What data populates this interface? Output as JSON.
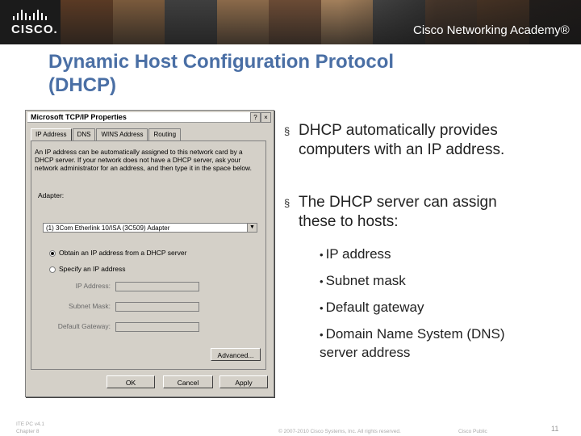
{
  "header": {
    "logo_text": "CISCO.",
    "academy_text": "Cisco Networking Academy®",
    "photo_colors": [
      "#5a3a24",
      "#7a5a3c",
      "#3f3f3f",
      "#8b6a4a",
      "#6b4b35",
      "#a27f5b",
      "#4d4d4d",
      "#7d5b43",
      "#905f3b",
      "#3a2e28"
    ]
  },
  "slide": {
    "title_line1": "Dynamic Host Configuration Protocol",
    "title_line2": "(DHCP)"
  },
  "dialog": {
    "title": "Microsoft TCP/IP Properties",
    "help_button": "?",
    "close_button": "×",
    "tabs": [
      "IP Address",
      "DNS",
      "WINS Address",
      "Routing"
    ],
    "description": "An IP address can be automatically assigned to this network card by a DHCP server. If your network does not have a DHCP server, ask your network administrator for an address, and then type it in the space below.",
    "adapter_label": "Adapter:",
    "adapter_value": "(1) 3Com Etherlink 10/ISA (3C509) Adapter",
    "radio_obtain": "Obtain an IP address from a DHCP server",
    "radio_specify": "Specify an IP address",
    "ip_label": "IP Address:",
    "subnet_label": "Subnet Mask:",
    "gateway_label": "Default Gateway:",
    "advanced_button": "Advanced...",
    "ok_button": "OK",
    "cancel_button": "Cancel",
    "apply_button": "Apply"
  },
  "bullets": {
    "marker": "§",
    "sub_marker": "•",
    "b1": "DHCP automatically provides computers with an IP address.",
    "b2": "The DHCP server can assign these to hosts:",
    "sub": [
      "IP address",
      "Subnet mask",
      "Default gateway",
      "Domain Name System (DNS) server address"
    ]
  },
  "footer": {
    "course": "ITE PC v4.1",
    "chapter": "Chapter 8",
    "copyright": "© 2007-2010 Cisco Systems, Inc. All rights reserved.",
    "classification": "Cisco Public",
    "page_number": "11"
  }
}
